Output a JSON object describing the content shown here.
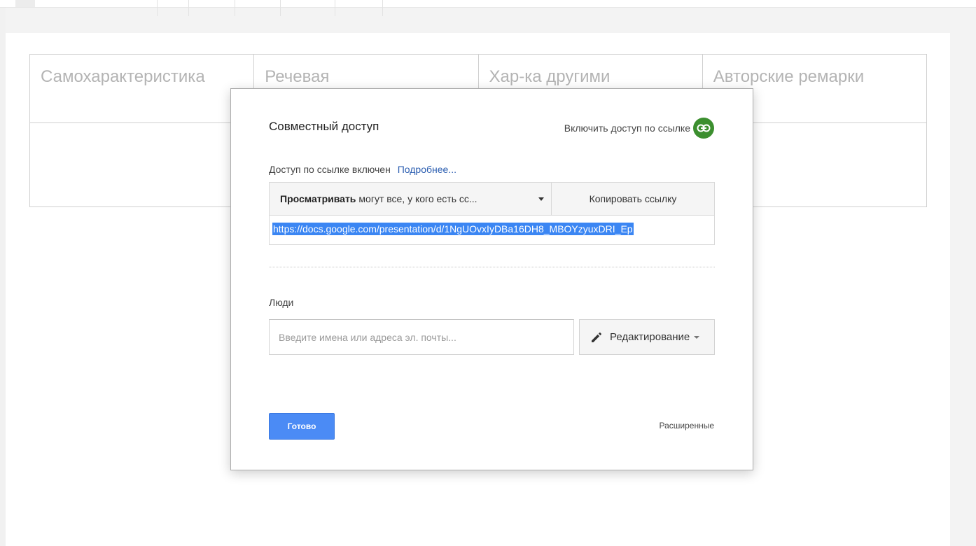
{
  "slide_table": {
    "headers": [
      "Самохарактеристика",
      "Речевая",
      "Хар-ка другими",
      "Авторские ремарки"
    ]
  },
  "dialog": {
    "title": "Совместный доступ",
    "link_toggle_label": "Включить доступ по ссылке",
    "link_status": "Доступ по ссылке включен",
    "more_link": "Подробнее...",
    "permission_bold": "Просматривать",
    "permission_rest": "могут все, у кого есть сс...",
    "copy_link": "Копировать ссылку",
    "url": "https://docs.google.com/presentation/d/1NgUOvxIyDBa16DH8_MBOYzyuxDRI_Ep",
    "people_label": "Люди",
    "people_placeholder": "Введите имена или адреса эл. почты...",
    "role_dropdown": "Редактирование",
    "done_button": "Готово",
    "advanced_link": "Расширенные"
  },
  "colors": {
    "accent_blue": "#4b8bf5",
    "link_green": "#3c8f2f",
    "link_text_blue": "#2a5db0"
  },
  "icons": [
    "link-icon",
    "pencil-icon",
    "chevron-down-icon"
  ]
}
